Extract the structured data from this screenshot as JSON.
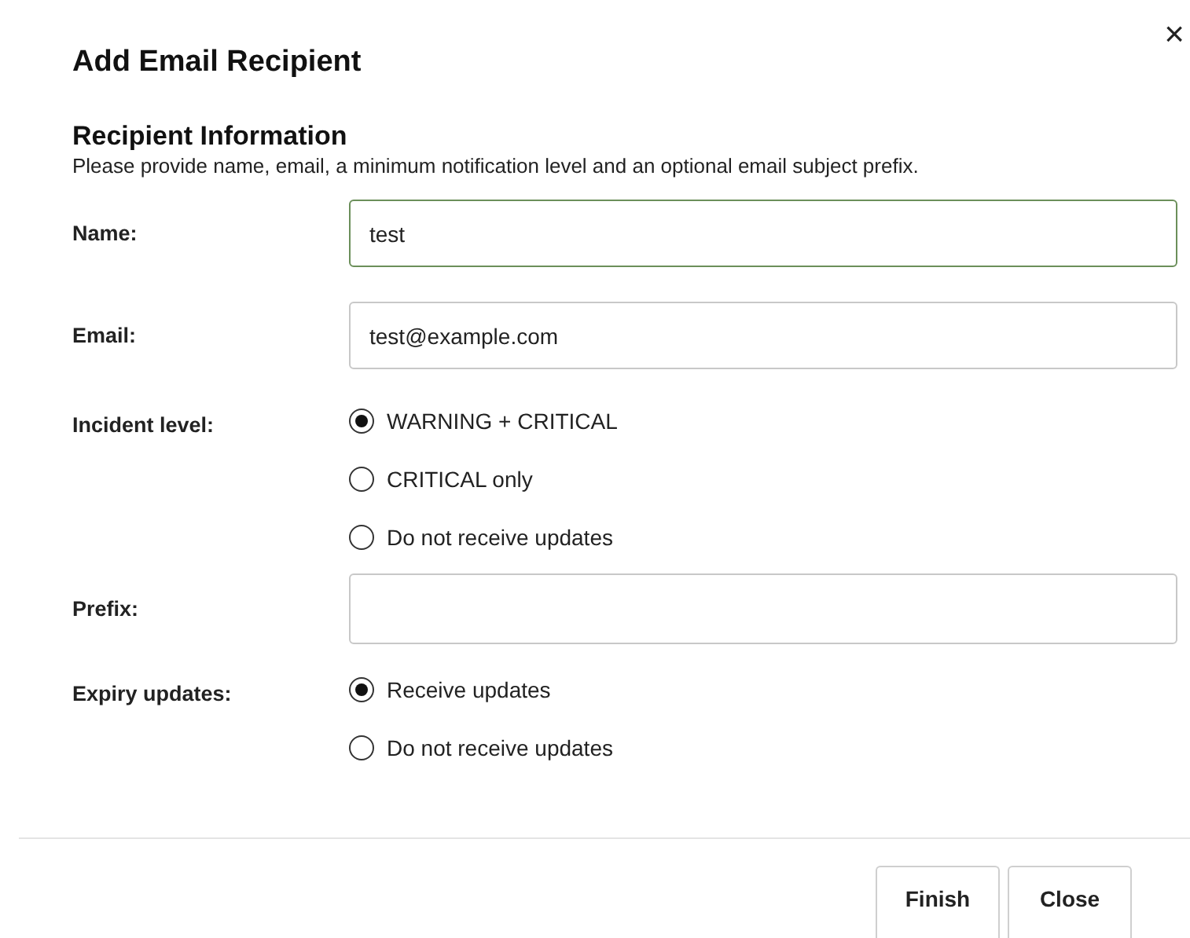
{
  "dialog": {
    "title": "Add Email Recipient",
    "close_icon": "×"
  },
  "section": {
    "heading": "Recipient Information",
    "description": "Please provide name, email, a minimum notification level and an optional email subject prefix."
  },
  "fields": [
    {
      "kind": "text",
      "label": "Name:",
      "value": "test",
      "focused": true
    },
    {
      "kind": "text",
      "label": "Email:",
      "value": "test@example.com",
      "focused": false
    },
    {
      "kind": "radio",
      "label": "Incident level:",
      "options": [
        {
          "label": "WARNING + CRITICAL",
          "selected": true
        },
        {
          "label": "CRITICAL only",
          "selected": false
        },
        {
          "label": "Do not receive updates",
          "selected": false
        }
      ]
    },
    {
      "kind": "text",
      "label": "Prefix:",
      "focused": false
    },
    {
      "kind": "radio",
      "label": "Expiry updates:",
      "options": [
        {
          "label": "Receive updates",
          "selected": true
        },
        {
          "label": "Do not receive updates",
          "selected": false
        }
      ]
    }
  ],
  "buttons": [
    "Finish",
    "Close"
  ]
}
